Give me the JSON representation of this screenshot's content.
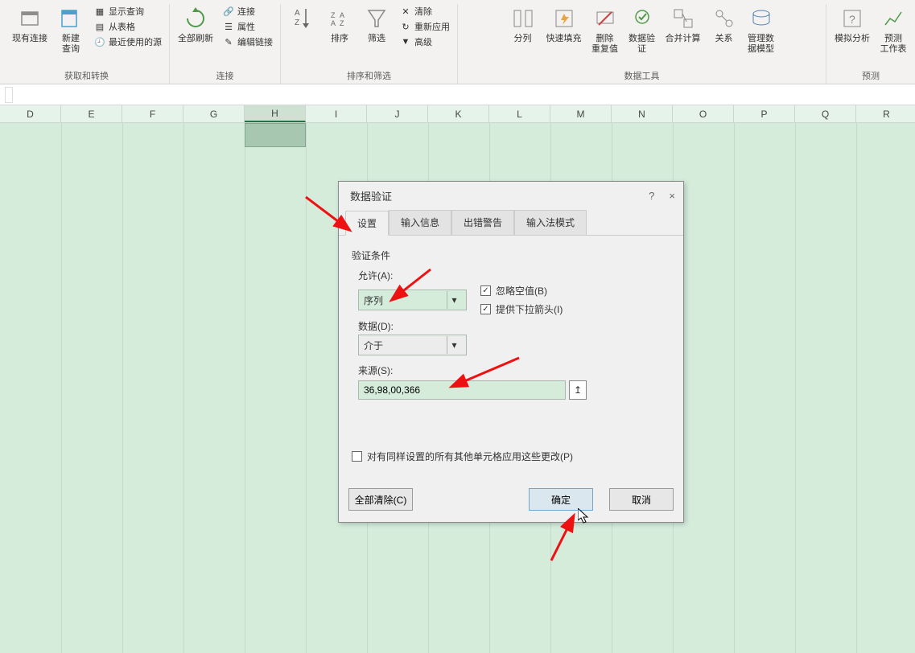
{
  "ribbon": {
    "groups": [
      {
        "label": "获取和转换",
        "bigButtons": [
          {
            "name": "existing-connections",
            "text": "现有连接"
          },
          {
            "name": "new-query",
            "text": "新建\n查询"
          }
        ],
        "stackItems": [
          {
            "icon": "table-icon",
            "text": "显示查询"
          },
          {
            "icon": "table-grid-icon",
            "text": "从表格"
          },
          {
            "icon": "recent-icon",
            "text": "最近使用的源"
          }
        ]
      },
      {
        "label": "连接",
        "bigButtons": [
          {
            "name": "refresh-all",
            "text": "全部刷新"
          }
        ],
        "stackItems": [
          {
            "icon": "link-icon",
            "text": "连接"
          },
          {
            "icon": "properties-icon",
            "text": "属性"
          },
          {
            "icon": "edit-links-icon",
            "text": "编辑链接"
          }
        ]
      },
      {
        "label": "排序和筛选",
        "bigButtons": [
          {
            "name": "sort-asc",
            "text": ""
          },
          {
            "name": "sort",
            "text": "排序"
          },
          {
            "name": "filter",
            "text": "筛选"
          }
        ],
        "stackItems": [
          {
            "icon": "clear-icon",
            "text": "清除"
          },
          {
            "icon": "reapply-icon",
            "text": "重新应用"
          },
          {
            "icon": "advanced-icon",
            "text": "高级"
          }
        ]
      },
      {
        "label": "数据工具",
        "bigButtons": [
          {
            "name": "text-to-columns",
            "text": "分列"
          },
          {
            "name": "flash-fill",
            "text": "快速填充"
          },
          {
            "name": "remove-dups",
            "text": "删除\n重复值"
          },
          {
            "name": "data-validation",
            "text": "数据验\n证"
          },
          {
            "name": "consolidate",
            "text": "合并计算"
          },
          {
            "name": "relationships",
            "text": "关系"
          },
          {
            "name": "manage-model",
            "text": "管理数\n据模型"
          }
        ]
      },
      {
        "label": "预测",
        "bigButtons": [
          {
            "name": "what-if",
            "text": "模拟分析"
          },
          {
            "name": "forecast",
            "text": "预测\n工作表"
          }
        ]
      }
    ]
  },
  "columns": [
    "D",
    "E",
    "F",
    "G",
    "H",
    "I",
    "J",
    "K",
    "L",
    "M",
    "N",
    "O",
    "P",
    "Q",
    "R"
  ],
  "selected_column": "H",
  "dialog": {
    "title": "数据验证",
    "help": "?",
    "close": "×",
    "tabs": [
      "设置",
      "输入信息",
      "出错警告",
      "输入法模式"
    ],
    "active_tab": 0,
    "validation_label": "验证条件",
    "allow_label": "允许(A):",
    "allow_value": "序列",
    "data_label": "数据(D):",
    "data_value": "介于",
    "ignore_blank": "忽略空值(B)",
    "provide_dropdown": "提供下拉箭头(I)",
    "source_label": "来源(S):",
    "source_value": "36,98,00,366",
    "apply_all": "对有同样设置的所有其他单元格应用这些更改(P)",
    "clear_all": "全部清除(C)",
    "ok": "确定",
    "cancel": "取消"
  }
}
